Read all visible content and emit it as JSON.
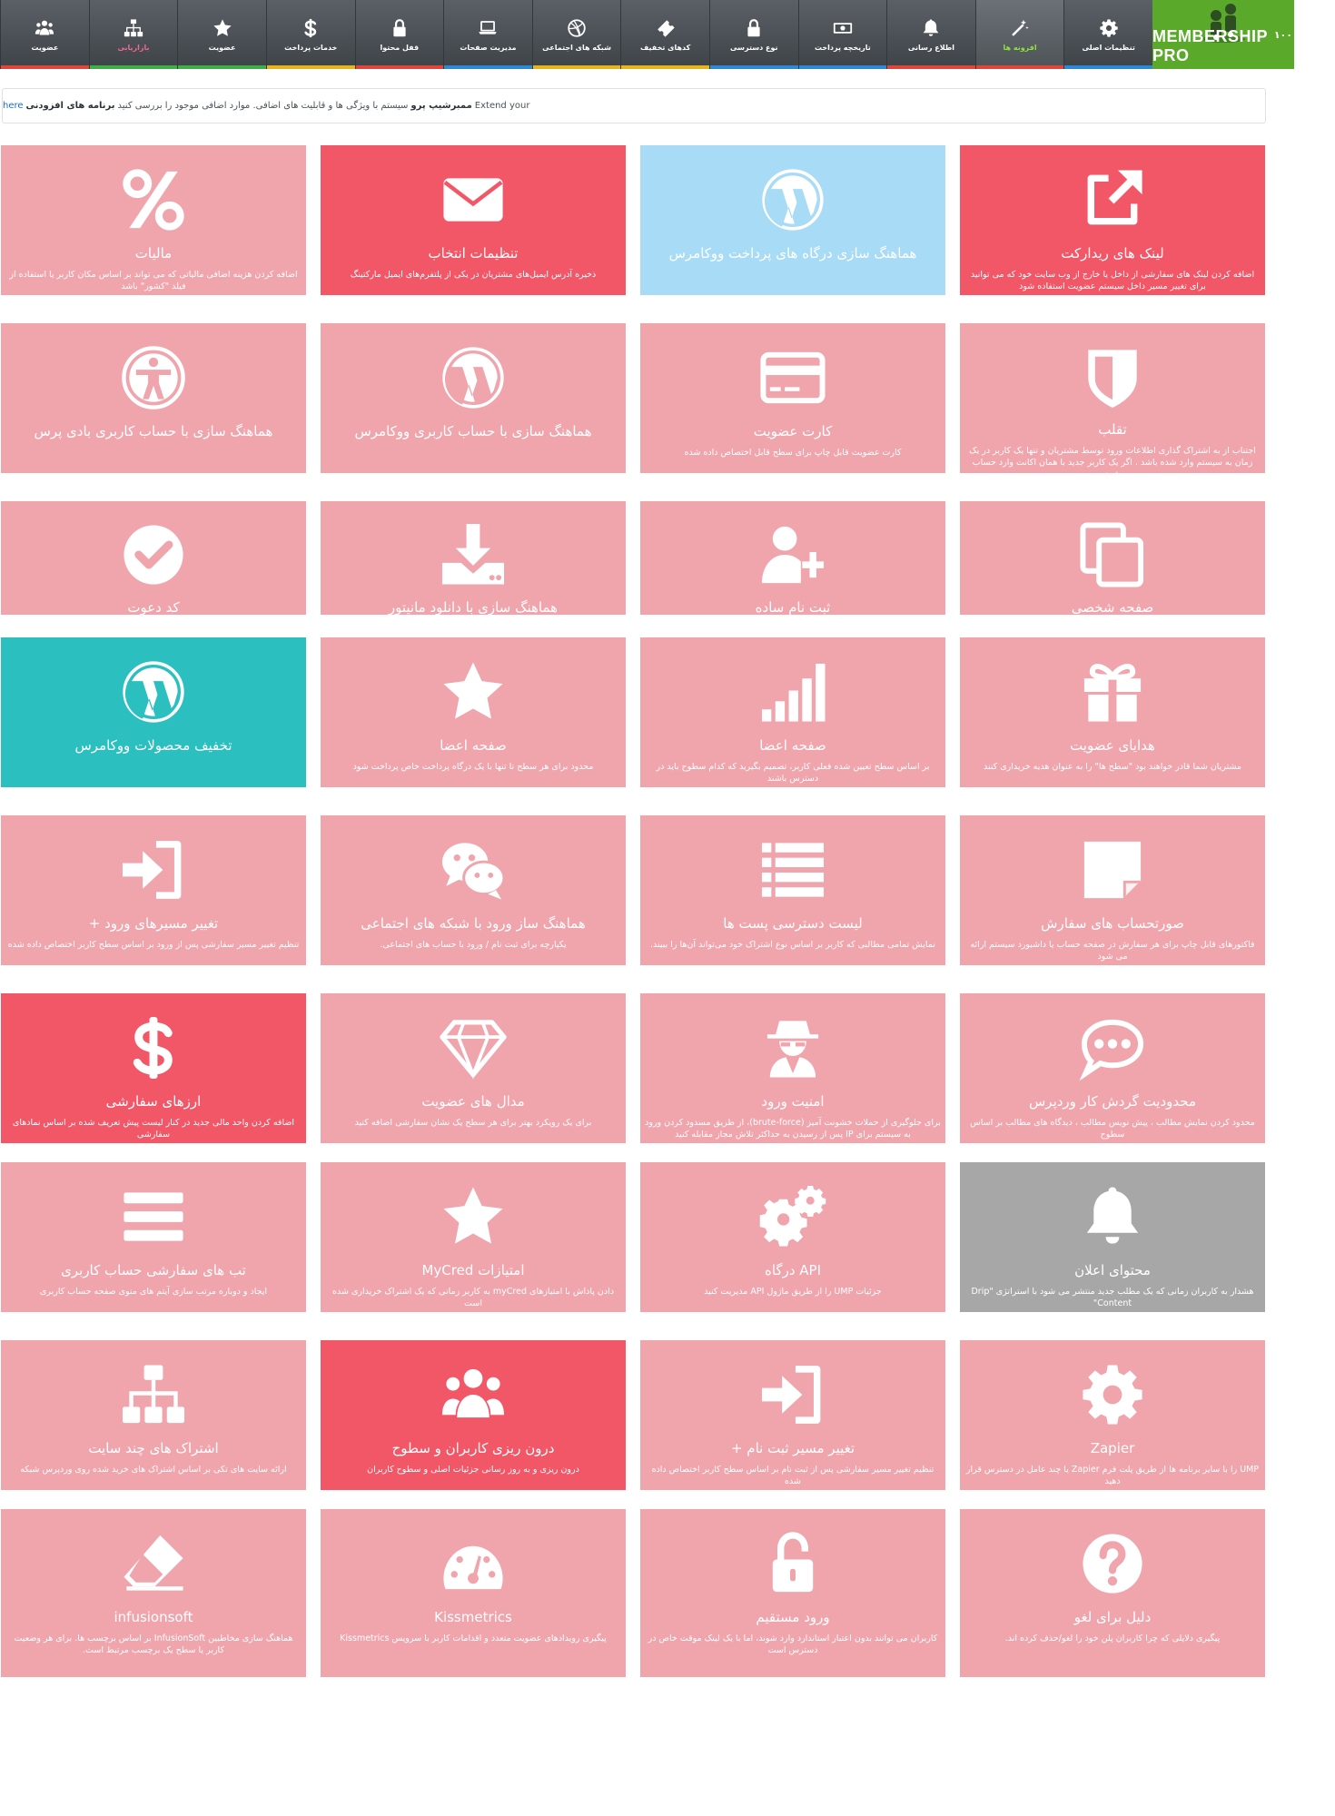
{
  "nav": {
    "logo_text": "MEMBERSHIP PRO",
    "logo_version": "۱۰۰",
    "items": [
      {
        "label": "تنظیمات اصلی",
        "icon": "gear-icon",
        "stripe": "#2b89d8"
      },
      {
        "label": "افزونه ها",
        "icon": "magic-wand-icon",
        "stripe": "#e0453c",
        "active": true
      },
      {
        "label": "اطلاع رسانی",
        "icon": "bell-icon",
        "stripe": "#e0453c"
      },
      {
        "label": "تاریخچه پرداخت",
        "icon": "money-icon",
        "stripe": "#2b89d8"
      },
      {
        "label": "نوع دسترسی",
        "icon": "lock-icon",
        "stripe": "#2b89d8"
      },
      {
        "label": "کدهای تخفیف",
        "icon": "ticket-icon",
        "stripe": "#e8b41e"
      },
      {
        "label": "شبکه های اجتماعی",
        "icon": "dribbble-icon",
        "stripe": "#e8b41e"
      },
      {
        "label": "مدیریت صفحات",
        "icon": "laptop-icon",
        "stripe": "#2b89d8"
      },
      {
        "label": "قفل محتوا",
        "icon": "lock-icon",
        "stripe": "#e0453c"
      },
      {
        "label": "خدمات پرداخت",
        "icon": "dollar-icon",
        "stripe": "#e8b41e"
      },
      {
        "label": "عضویت",
        "icon": "star-icon",
        "stripe": "#3fae49"
      },
      {
        "label": "بازاریابی",
        "icon": "sitemap-icon",
        "stripe": "#3fae49",
        "active_pink": true
      },
      {
        "label": "عضویت",
        "icon": "users-icon",
        "stripe": "#e0453c"
      }
    ]
  },
  "notice": {
    "part1": "Extend your",
    "brand": "ممبرشیپ پرو",
    "part2": "سیستم با ویژگی ها و قابلیت های اضافی. موارد اضافی موجود را بررسی کنید",
    "link_bold": "برنامه های افزودنی",
    "link": "here"
  },
  "colors": {
    "pink": "#f0a5ad",
    "red": "#f25767",
    "light_blue": "#a8dbf5",
    "teal": "#2bbfbf",
    "gray": "#a7a7a7"
  },
  "cards": [
    {
      "title": "لینک های ریدارکت",
      "desc": "اضافه کردن لینک های سفارشی از داخل یا خارج از وب سایت خود که می توانید برای تغییر مسیر داخل سیستم عضویت استفاده شود",
      "icon": "external-link-icon",
      "color": "red"
    },
    {
      "title": "هماهنگ سازی درگاه های پرداخت ووکامرس",
      "desc": "",
      "icon": "wordpress-icon",
      "color": "light_blue"
    },
    {
      "title": "تنظیمات انتخاب",
      "desc": "ذخیره آدرس ایمیل‌های مشتریان در یکی از پلتفرم‌های ایمیل مارکتینگ",
      "icon": "envelope-icon",
      "color": "red"
    },
    {
      "title": "مالیات",
      "desc": "اضافه کردن هزینه اضافی مالیاتی که می تواند بر اساس مکان کاربر یا استفاده از فیلد \"کشور\" باشد",
      "icon": "percent-icon",
      "color": "pink"
    },
    {
      "title": "تقلب",
      "desc": "اجتناب از به اشتراک گذاری اطلاعات ورود توسط مشتریان و تنها یک کاربر در یک زمان به سیستم وارد شده باشد . اگر یک کاربر جدید با همان اکانت وارد حساب شود",
      "icon": "shield-icon",
      "color": "pink"
    },
    {
      "title": "کارت عضویت",
      "desc": "کارت عضویت قابل چاپ برای سطح قابل اختصاص داده شده",
      "icon": "credit-card-icon",
      "color": "pink"
    },
    {
      "title": "هماهنگ سازی با حساب کاربری ووکامرس",
      "desc": "",
      "icon": "wordpress-icon",
      "color": "pink"
    },
    {
      "title": "هماهنگ سازی با حساب کاربری بادی پرس",
      "desc": "",
      "icon": "universal-access-icon",
      "color": "pink"
    },
    {
      "title": "صفحه شخصی",
      "desc": "",
      "icon": "copy-icon",
      "color": "pink"
    },
    {
      "title": "ثبت نام ساده",
      "desc": "",
      "icon": "user-plus-icon",
      "color": "pink"
    },
    {
      "title": "هماهنگ سازی با دانلود مانیتور",
      "desc": "",
      "icon": "download-icon",
      "color": "pink"
    },
    {
      "title": "کد دعوت",
      "desc": "",
      "icon": "check-circle-icon",
      "color": "pink"
    },
    {
      "title": "هدایای عضویت",
      "desc": "مشتریان شما قادر خواهند بود \"سطح ها\" را به عنوان هدیه خریداری کنند",
      "icon": "gift-icon",
      "color": "pink"
    },
    {
      "title": "صفحه اعضا",
      "desc": "بر اساس سطح تعیین شده فعلی کاربر، تصمیم بگیرید که کدام سطوح باید در دسترس باشند",
      "icon": "signal-icon",
      "color": "pink"
    },
    {
      "title": "صفحه اعضا",
      "desc": "محدود برای هر سطح تا تنها با یک درگاه پرداخت خاص پرداخت شود",
      "icon": "star-icon",
      "color": "pink"
    },
    {
      "title": "تخفیف محصولات ووکامرس",
      "desc": "",
      "icon": "wordpress-icon",
      "color": "teal"
    },
    {
      "title": "صورتحساب های سفارش",
      "desc": "فاکتورهای قابل چاپ برای هر سفارش در صفحه حساب یا داشبورد سیستم ارائه می شود",
      "icon": "sticky-note-icon",
      "color": "pink"
    },
    {
      "title": "لیست دسترسی پست ها",
      "desc": "نمایش تمامی مطالبی که کاربر بر اساس نوع اشتراک خود می‌تواند آن‌ها را ببیند.",
      "icon": "list-icon",
      "color": "pink"
    },
    {
      "title": "هماهنگ ساز ورود با شبکه های اجتماعی",
      "desc": "یکپارچه برای ثبت نام / ورود با حساب های اجتماعی.",
      "icon": "wechat-icon",
      "color": "pink"
    },
    {
      "title": "تغییر مسیرهای ورود +",
      "desc": "تنظیم تغییر مسیر سفارشی پس از ورود بر اساس سطح کاربر اختصاص داده شده",
      "icon": "sign-in-icon",
      "color": "pink"
    },
    {
      "title": "محدودیت گردش کار وردپرس",
      "desc": "محدود کردن نمایش مطالب ، پیش نویس مطالب ، دیدگاه های مطالب بر اساس سطوح",
      "icon": "comment-dots-icon",
      "color": "pink"
    },
    {
      "title": "امنیت ورود",
      "desc": "برای جلوگیری از حملات خشونت آمیز (brute-force)، از طریق مسدود کردن ورود به سیستم برای IP پس از رسیدن به حداکثر تلاش مجاز مقابله کنید",
      "icon": "user-secret-icon",
      "color": "pink"
    },
    {
      "title": "مدال های عضویت",
      "desc": "برای یک رویکرد بهتر برای هر سطح یک نشان سفارشی اضافه کنید",
      "icon": "diamond-icon",
      "color": "pink"
    },
    {
      "title": "ارزهای سفارشی",
      "desc": "اضافه کردن واحد مالی جدید در کنار لیست پیش تعریف شده بر اساس نمادهای سفارشی",
      "icon": "dollar-icon",
      "color": "red"
    },
    {
      "title": "محتوای اعلان",
      "desc": "هشدار به کاربران زمانی که یک مطلب جدید منتشر می شود با استراتژی \"Drip Content\"",
      "icon": "bell-icon",
      "color": "gray"
    },
    {
      "title": "API درگاه",
      "desc": "جزئیات UMP را از طریق ماژول API مدیریت کنید",
      "icon": "cogs-icon",
      "color": "pink"
    },
    {
      "title": "امتیازات MyCred",
      "desc": "دادن پاداش با امتیازهای myCred به کاربر زمانی که یک اشتراک خریداری شده است",
      "icon": "star-icon",
      "color": "pink"
    },
    {
      "title": "تب های سفارشی حساب کاربری",
      "desc": "ایجاد و دوباره مرتب سازی آیتم های منوی صفحه حساب کاربری",
      "icon": "bars-icon",
      "color": "pink"
    },
    {
      "title": "Zapier",
      "desc": "UMP را با سایر برنامه ها از طریق پلت فرم Zapier یا چند عامل در دسترس قرار دهید",
      "icon": "cog-icon",
      "color": "pink"
    },
    {
      "title": "تغییر مسیر ثبت نام +",
      "desc": "تنظیم تغییر مسیر سفارشی پس از ثبت نام بر اساس سطح کاربر اختصاص داده شده",
      "icon": "sign-in-icon",
      "color": "pink"
    },
    {
      "title": "درون ریزی کاربران و سطوح",
      "desc": "درون ریزی و به روز رسانی جزئیات اصلی و سطوح کاربران",
      "icon": "users-icon",
      "color": "red"
    },
    {
      "title": "اشتراک های چند سایت",
      "desc": "ارائه سایت های تکی بر اساس اشتراک های خرید شده روی وردپرس شبکه",
      "icon": "sitemap-icon",
      "color": "pink"
    },
    {
      "title": "دلیل برای لغو",
      "desc": "پیگیری دلایلی که چرا کاربران پلن خود را لغو/حذف کرده اند.",
      "icon": "question-circle-icon",
      "color": "pink"
    },
    {
      "title": "ورود مستقیم",
      "desc": "کاربران می توانند بدون اعتبار استاندارد وارد شوند، اما با یک لینک موقت خاص در دسترس است",
      "icon": "unlock-icon",
      "color": "pink"
    },
    {
      "title": "Kissmetrics",
      "desc": "پیگیری رویدادهای عضویت متعدد و اقدامات کاربر با سرویس Kissmetrics",
      "icon": "dashboard-icon",
      "color": "pink"
    },
    {
      "title": "infusionsoft",
      "desc": "هماهنگ سازی مخاطبین InfusionSoft بر اساس برچسب ها. برای هر وضعیت کاربر یا سطح یک برچسب مرتبط است.",
      "icon": "eraser-icon",
      "color": "pink"
    }
  ]
}
